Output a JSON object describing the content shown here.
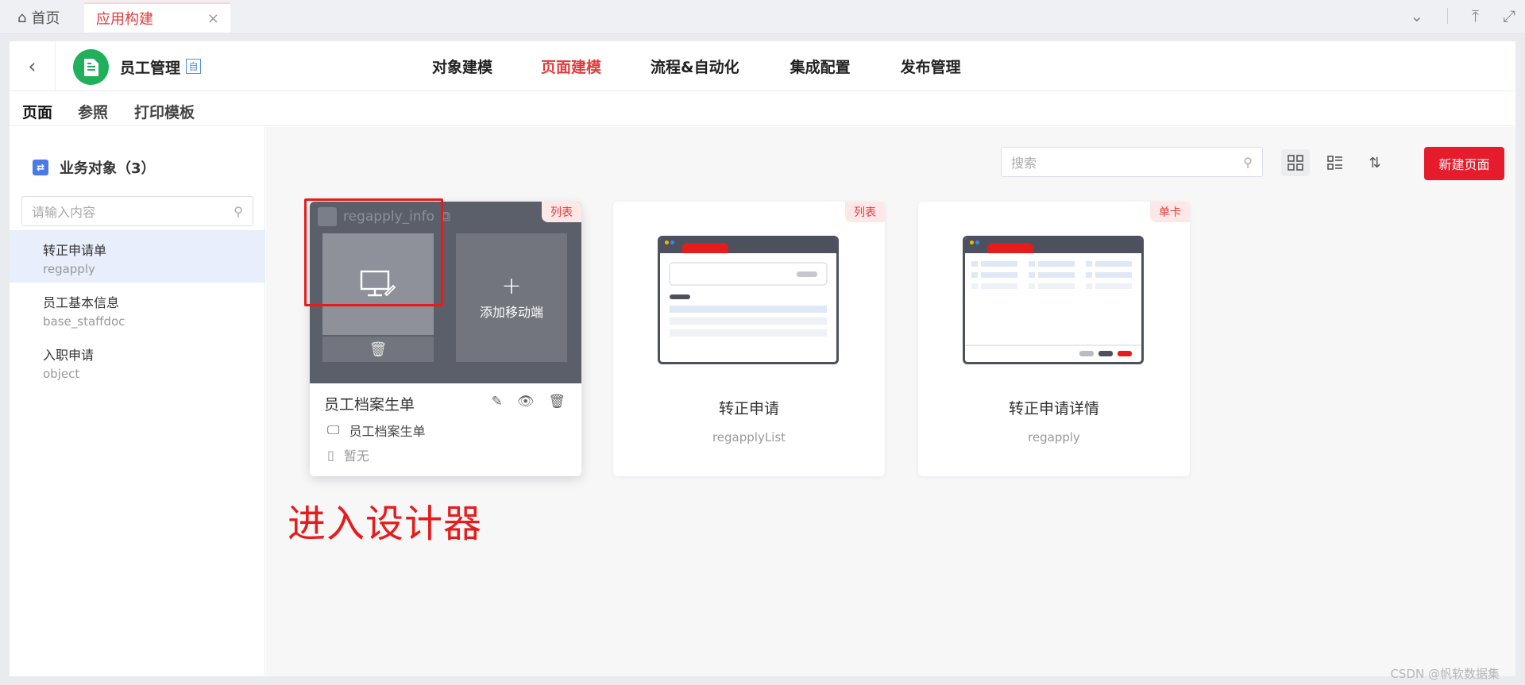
{
  "tabs": {
    "home": "首页",
    "active": "应用构建",
    "close": "×"
  },
  "app": {
    "name": "员工管理",
    "badge": "自",
    "nav": [
      "对象建模",
      "页面建模",
      "流程&自动化",
      "集成配置",
      "发布管理"
    ],
    "active_nav": "页面建模"
  },
  "subtabs": [
    "页面",
    "参照",
    "打印模板"
  ],
  "sidebar": {
    "title": "业务对象（3）",
    "search_placeholder": "请输入内容",
    "items": [
      {
        "title": "转正申请单",
        "code": "regapply"
      },
      {
        "title": "员工基本信息",
        "code": "base_staffdoc"
      },
      {
        "title": "入职申请",
        "code": "object"
      }
    ]
  },
  "toolbar": {
    "search_placeholder": "搜索",
    "new_button": "新建页面"
  },
  "cards": [
    {
      "tag": "列表",
      "header_code": "regapply_info",
      "add_mobile": "添加移动端",
      "name": "员工档案生单",
      "pc_label": "员工档案生单",
      "mobile_label": "暂无"
    },
    {
      "tag": "列表",
      "name": "转正申请",
      "code": "regapplyList"
    },
    {
      "tag": "单卡",
      "name": "转正申请详情",
      "code": "regapply"
    }
  ],
  "annotation": "进入设计器",
  "watermark": "CSDN @帆软数据集"
}
